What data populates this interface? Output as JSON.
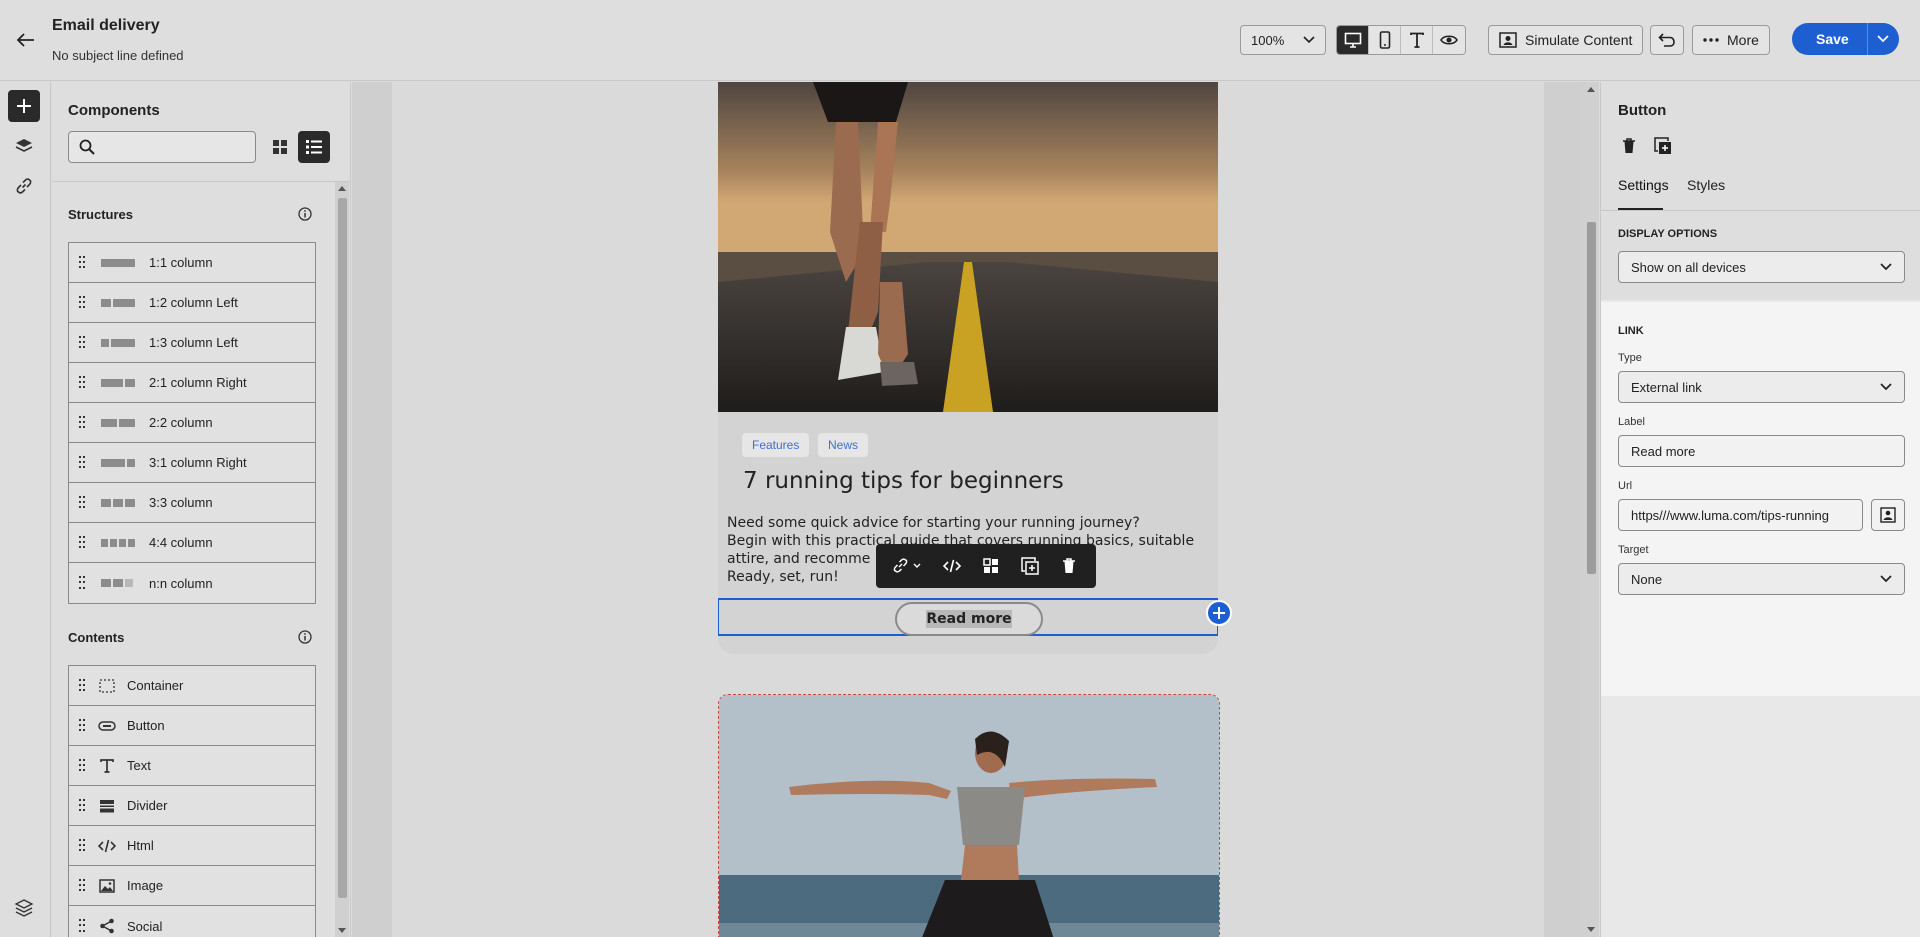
{
  "header": {
    "title": "Email delivery",
    "subtitle": "No subject line defined",
    "zoom": "100%",
    "simulate_label": "Simulate Content",
    "more_label": "More",
    "save_label": "Save"
  },
  "components": {
    "title": "Components",
    "search_placeholder": "",
    "structures_title": "Structures",
    "structures": [
      {
        "label": "1:1 column"
      },
      {
        "label": "1:2 column Left"
      },
      {
        "label": "1:3 column Left"
      },
      {
        "label": "2:1 column Right"
      },
      {
        "label": "2:2 column"
      },
      {
        "label": "3:1 column Right"
      },
      {
        "label": "3:3 column"
      },
      {
        "label": "4:4 column"
      },
      {
        "label": "n:n column"
      }
    ],
    "contents_title": "Contents",
    "contents": [
      {
        "label": "Container",
        "icon": "container-icon"
      },
      {
        "label": "Button",
        "icon": "button-icon"
      },
      {
        "label": "Text",
        "icon": "text-icon"
      },
      {
        "label": "Divider",
        "icon": "divider-icon"
      },
      {
        "label": "Html",
        "icon": "html-icon"
      },
      {
        "label": "Image",
        "icon": "image-icon"
      },
      {
        "label": "Social",
        "icon": "social-icon"
      }
    ]
  },
  "canvas": {
    "tags": [
      "Features",
      "News"
    ],
    "article_title": "7 running tips for beginners",
    "article_body": [
      "Need some quick advice for starting your running journey?",
      "Begin with this practical guide that covers running basics, suitable",
      "attire, and recomme",
      "Ready, set, run!"
    ],
    "button_label": "Read more"
  },
  "properties": {
    "title": "Button",
    "tabs": [
      "Settings",
      "Styles"
    ],
    "display_options_label": "DISPLAY OPTIONS",
    "display_options_value": "Show on all devices",
    "link_label": "LINK",
    "type_label": "Type",
    "type_value": "External link",
    "label_label": "Label",
    "label_value": "Read more",
    "url_label": "Url",
    "url_value": "https///www.luma.com/tips-running",
    "target_label": "Target",
    "target_value": "None"
  },
  "colors": {
    "accent": "#1d5fd1",
    "tag_text": "#3d6fd1"
  }
}
